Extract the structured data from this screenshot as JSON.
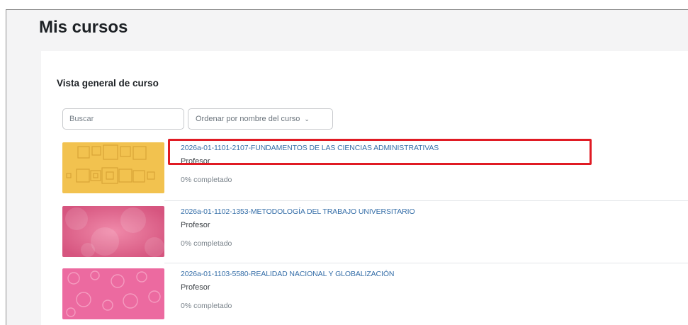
{
  "page": {
    "title": "Mis cursos"
  },
  "overview": {
    "title": "Vista general de curso",
    "search_placeholder": "Buscar",
    "sort_label": "Ordenar por nombre del curso"
  },
  "courses": [
    {
      "name": "2026a-01-1101-2107-FUNDAMENTOS DE LAS CIENCIAS ADMINISTRATIVAS",
      "role": "Profesor",
      "progress_text": "0% completado",
      "progress": 0,
      "thumb_color": "#f2c24f",
      "highlighted": true
    },
    {
      "name": "2026a-01-1102-1353-METODOLOGÍA DEL TRABAJO UNIVERSITARIO",
      "role": "Profesor",
      "progress_text": "0% completado",
      "progress": 0,
      "thumb_color": "#e06a93",
      "highlighted": false
    },
    {
      "name": "2026a-01-1103-5580-REALIDAD NACIONAL Y GLOBALIZACIÓN",
      "role": "Profesor",
      "progress_text": "0% completado",
      "progress": 0,
      "thumb_color": "#ec6aa0",
      "highlighted": false
    }
  ],
  "colors": {
    "link": "#356ea8",
    "highlight_border": "#e01b24"
  }
}
